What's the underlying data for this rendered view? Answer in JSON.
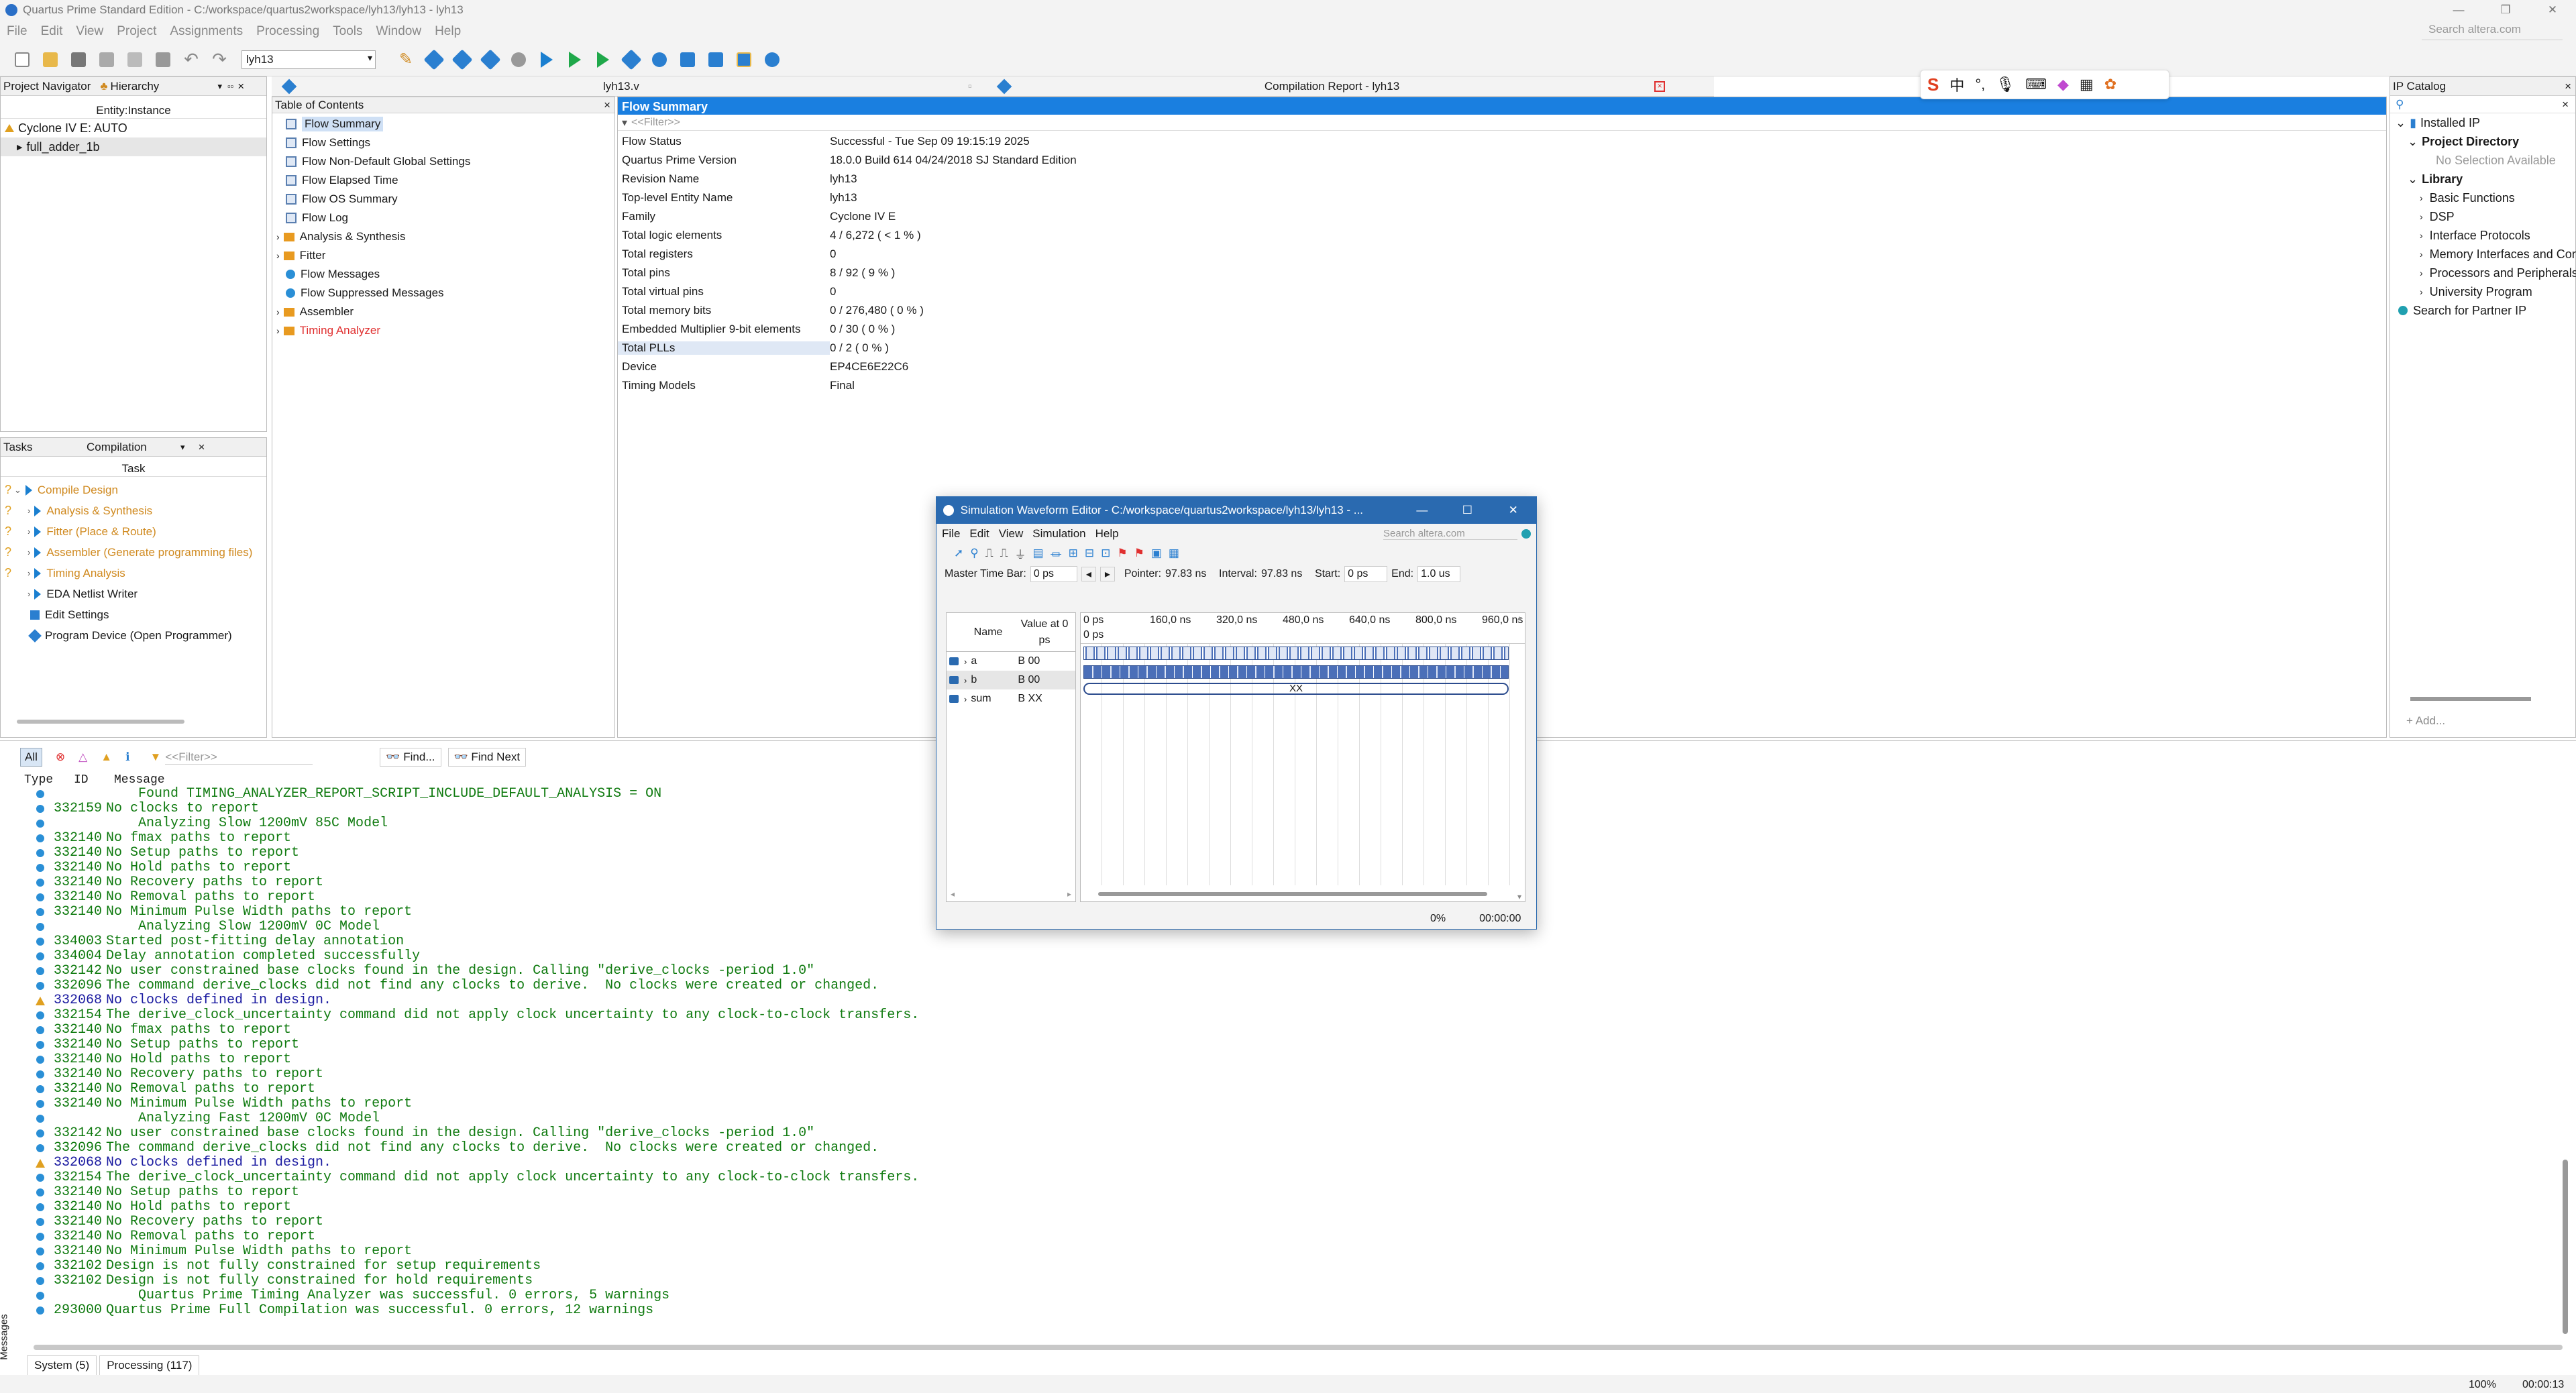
{
  "window": {
    "title": "Quartus Prime Standard Edition - C:/workspace/quartus2workspace/lyh13/lyh13 - lyh13",
    "search_placeholder": "Search altera.com"
  },
  "menu": [
    "File",
    "Edit",
    "View",
    "Project",
    "Assignments",
    "Processing",
    "Tools",
    "Window",
    "Help"
  ],
  "toolbar": {
    "entity_combo": "lyh13"
  },
  "project_navigator": {
    "title": "Project Navigator",
    "mode": "Hierarchy",
    "column": "Entity:Instance",
    "device": "Cyclone IV E: AUTO",
    "top": "full_adder_1b"
  },
  "tasks": {
    "title": "Tasks",
    "mode": "Compilation",
    "column": "Task",
    "items": [
      {
        "label": "Compile Design",
        "status": "?"
      },
      {
        "label": "Analysis & Synthesis",
        "status": "?"
      },
      {
        "label": "Fitter (Place & Route)",
        "status": "?"
      },
      {
        "label": "Assembler (Generate programming files)",
        "status": "?"
      },
      {
        "label": "Timing Analysis",
        "status": "?"
      },
      {
        "label": "EDA Netlist Writer",
        "status": ""
      },
      {
        "label": "Edit Settings",
        "status": ""
      },
      {
        "label": "Program Device (Open Programmer)",
        "status": ""
      }
    ]
  },
  "tabs": {
    "file_tab": "lyh13.v",
    "report_tab": "Compilation Report - lyh13"
  },
  "toc": {
    "title": "Table of Contents",
    "items": [
      "Flow Summary",
      "Flow Settings",
      "Flow Non-Default Global Settings",
      "Flow Elapsed Time",
      "Flow OS Summary",
      "Flow Log",
      "Analysis & Synthesis",
      "Fitter",
      "Flow Messages",
      "Flow Suppressed Messages",
      "Assembler",
      "Timing Analyzer"
    ]
  },
  "report": {
    "title": "Flow Summary",
    "filter": "<<Filter>>",
    "rows": [
      {
        "k": "Flow Status",
        "v": "Successful - Tue Sep 09 19:15:19 2025"
      },
      {
        "k": "Quartus Prime Version",
        "v": "18.0.0 Build 614 04/24/2018 SJ Standard Edition"
      },
      {
        "k": "Revision Name",
        "v": "lyh13"
      },
      {
        "k": "Top-level Entity Name",
        "v": "lyh13"
      },
      {
        "k": "Family",
        "v": "Cyclone IV E"
      },
      {
        "k": "Total logic elements",
        "v": "4 / 6,272 ( < 1 % )"
      },
      {
        "k": "Total registers",
        "v": "0"
      },
      {
        "k": "Total pins",
        "v": "8 / 92 ( 9 % )"
      },
      {
        "k": "Total virtual pins",
        "v": "0"
      },
      {
        "k": "Total memory bits",
        "v": "0 / 276,480 ( 0 % )"
      },
      {
        "k": "Embedded Multiplier 9-bit elements",
        "v": "0 / 30 ( 0 % )"
      },
      {
        "k": "Total PLLs",
        "v": "0 / 2 ( 0 % )"
      },
      {
        "k": "Device",
        "v": "EP4CE6E22C6"
      },
      {
        "k": "Timing Models",
        "v": "Final"
      }
    ]
  },
  "ip": {
    "title": "IP Catalog",
    "installed": "Installed IP",
    "project_dir": "Project Directory",
    "no_sel": "No Selection Available",
    "library": "Library",
    "items": [
      "Basic Functions",
      "DSP",
      "Interface Protocols",
      "Memory Interfaces and Controllers",
      "Processors and Peripherals",
      "University Program"
    ],
    "partner": "Search for Partner IP",
    "add": "+ Add..."
  },
  "messages": {
    "all": "All",
    "filter": "<<Filter>>",
    "find": "Find...",
    "find_next": "Find Next",
    "cols": [
      "Type",
      "ID",
      "Message"
    ],
    "lines": [
      {
        "id": "",
        "t": "    Found TIMING_ANALYZER_REPORT_SCRIPT_INCLUDE_DEFAULT_ANALYSIS = ON",
        "w": false
      },
      {
        "id": "332159",
        "t": "No clocks to report",
        "w": false
      },
      {
        "id": "",
        "t": "    Analyzing Slow 1200mV 85C Model",
        "w": false
      },
      {
        "id": "332140",
        "t": "No fmax paths to report",
        "w": false
      },
      {
        "id": "332140",
        "t": "No Setup paths to report",
        "w": false
      },
      {
        "id": "332140",
        "t": "No Hold paths to report",
        "w": false
      },
      {
        "id": "332140",
        "t": "No Recovery paths to report",
        "w": false
      },
      {
        "id": "332140",
        "t": "No Removal paths to report",
        "w": false
      },
      {
        "id": "332140",
        "t": "No Minimum Pulse Width paths to report",
        "w": false
      },
      {
        "id": "",
        "t": "    Analyzing Slow 1200mV 0C Model",
        "w": false
      },
      {
        "id": "334003",
        "t": "Started post-fitting delay annotation",
        "w": false
      },
      {
        "id": "334004",
        "t": "Delay annotation completed successfully",
        "w": false
      },
      {
        "id": "332142",
        "t": "No user constrained base clocks found in the design. Calling \"derive_clocks -period 1.0\"",
        "w": false
      },
      {
        "id": "332096",
        "t": "The command derive_clocks did not find any clocks to derive.  No clocks were created or changed.",
        "w": false
      },
      {
        "id": "332068",
        "t": "No clocks defined in design.",
        "w": true
      },
      {
        "id": "332154",
        "t": "The derive_clock_uncertainty command did not apply clock uncertainty to any clock-to-clock transfers.",
        "w": false
      },
      {
        "id": "332140",
        "t": "No fmax paths to report",
        "w": false
      },
      {
        "id": "332140",
        "t": "No Setup paths to report",
        "w": false
      },
      {
        "id": "332140",
        "t": "No Hold paths to report",
        "w": false
      },
      {
        "id": "332140",
        "t": "No Recovery paths to report",
        "w": false
      },
      {
        "id": "332140",
        "t": "No Removal paths to report",
        "w": false
      },
      {
        "id": "332140",
        "t": "No Minimum Pulse Width paths to report",
        "w": false
      },
      {
        "id": "",
        "t": "    Analyzing Fast 1200mV 0C Model",
        "w": false
      },
      {
        "id": "332142",
        "t": "No user constrained base clocks found in the design. Calling \"derive_clocks -period 1.0\"",
        "w": false
      },
      {
        "id": "332096",
        "t": "The command derive_clocks did not find any clocks to derive.  No clocks were created or changed.",
        "w": false
      },
      {
        "id": "332068",
        "t": "No clocks defined in design.",
        "w": true
      },
      {
        "id": "332154",
        "t": "The derive_clock_uncertainty command did not apply clock uncertainty to any clock-to-clock transfers.",
        "w": false
      },
      {
        "id": "332140",
        "t": "No Setup paths to report",
        "w": false
      },
      {
        "id": "332140",
        "t": "No Hold paths to report",
        "w": false
      },
      {
        "id": "332140",
        "t": "No Recovery paths to report",
        "w": false
      },
      {
        "id": "332140",
        "t": "No Removal paths to report",
        "w": false
      },
      {
        "id": "332140",
        "t": "No Minimum Pulse Width paths to report",
        "w": false
      },
      {
        "id": "332102",
        "t": "Design is not fully constrained for setup requirements",
        "w": false
      },
      {
        "id": "332102",
        "t": "Design is not fully constrained for hold requirements",
        "w": false
      },
      {
        "id": "",
        "t": "    Quartus Prime Timing Analyzer was successful. 0 errors, 5 warnings",
        "w": false
      },
      {
        "id": "293000",
        "t": "Quartus Prime Full Compilation was successful. 0 errors, 12 warnings",
        "w": false
      }
    ],
    "bottom_tabs": [
      "System (5)",
      "Processing (117)"
    ],
    "side_label": "Messages"
  },
  "status": {
    "zoom": "100%",
    "time": "00:00:13"
  },
  "sim": {
    "title": "Simulation Waveform Editor - C:/workspace/quartus2workspace/lyh13/lyh13 - ...",
    "menu": [
      "File",
      "Edit",
      "View",
      "Simulation",
      "Help"
    ],
    "search": "Search altera.com",
    "master_label": "Master Time Bar:",
    "master": "0 ps",
    "pointer_label": "Pointer:",
    "pointer": "97.83 ns",
    "interval_label": "Interval:",
    "interval": "97.83 ns",
    "start_label": "Start:",
    "start": "0 ps",
    "end_label": "End:",
    "end": "1.0 us",
    "col_name": "Name",
    "col_value": "Value at 0 ps",
    "ruler": [
      "0 ps",
      "160,0 ns",
      "320,0 ns",
      "480,0 ns",
      "640,0 ns",
      "800,0 ns",
      "960,0 ns"
    ],
    "ruler2": "0 ps",
    "signals": [
      {
        "name": "a",
        "value": "B 00"
      },
      {
        "name": "b",
        "value": "B 00"
      },
      {
        "name": "sum",
        "value": "B XX"
      }
    ],
    "xx": "XX",
    "progress": "0%",
    "elapsed": "00:00:00"
  }
}
